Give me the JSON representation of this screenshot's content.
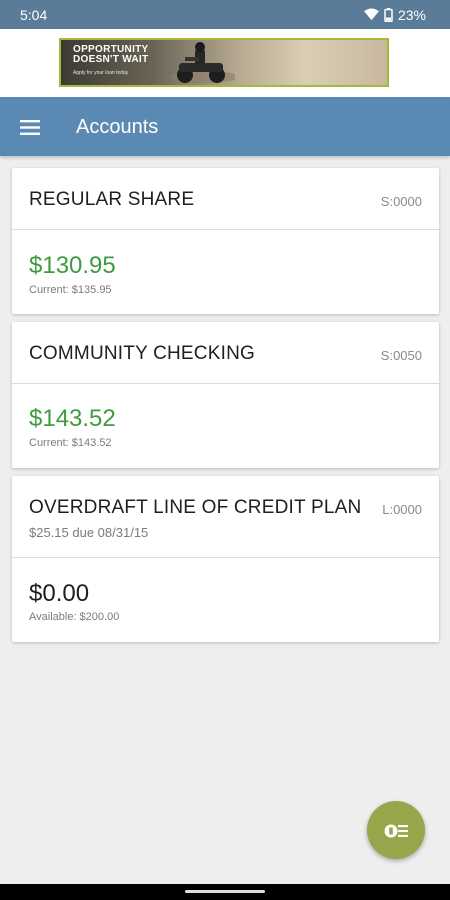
{
  "status_bar": {
    "time": "5:04",
    "battery": "23%",
    "icons": [
      "wifi-icon",
      "battery-icon"
    ]
  },
  "ad": {
    "headline_line1": "OPPORTUNITY",
    "headline_line2": "DOESN'T WAIT",
    "subtext": "Apply for your loan today",
    "border_color": "#a7b83a"
  },
  "app_bar": {
    "title": "Accounts",
    "menu_icon": "hamburger-menu-icon",
    "color": "#5a89b3"
  },
  "accounts": [
    {
      "name": "REGULAR SHARE",
      "code": "S:0000",
      "due_text": "",
      "amount": "$130.95",
      "detail": "Current: $135.95",
      "amount_color": "#3f9b3f"
    },
    {
      "name": "COMMUNITY CHECKING",
      "code": "S:0050",
      "due_text": "",
      "amount": "$143.52",
      "detail": "Current: $143.52",
      "amount_color": "#3f9b3f"
    },
    {
      "name": "OVERDRAFT LINE OF CREDIT PLAN",
      "code": "L:0000",
      "due_text": "$25.15 due 08/31/15",
      "amount": "$0.00",
      "detail": "Available: $200.00",
      "amount_color": "#1f1f1f"
    }
  ],
  "fab": {
    "icon": "transfer-money-icon",
    "color": "#95a64b"
  }
}
